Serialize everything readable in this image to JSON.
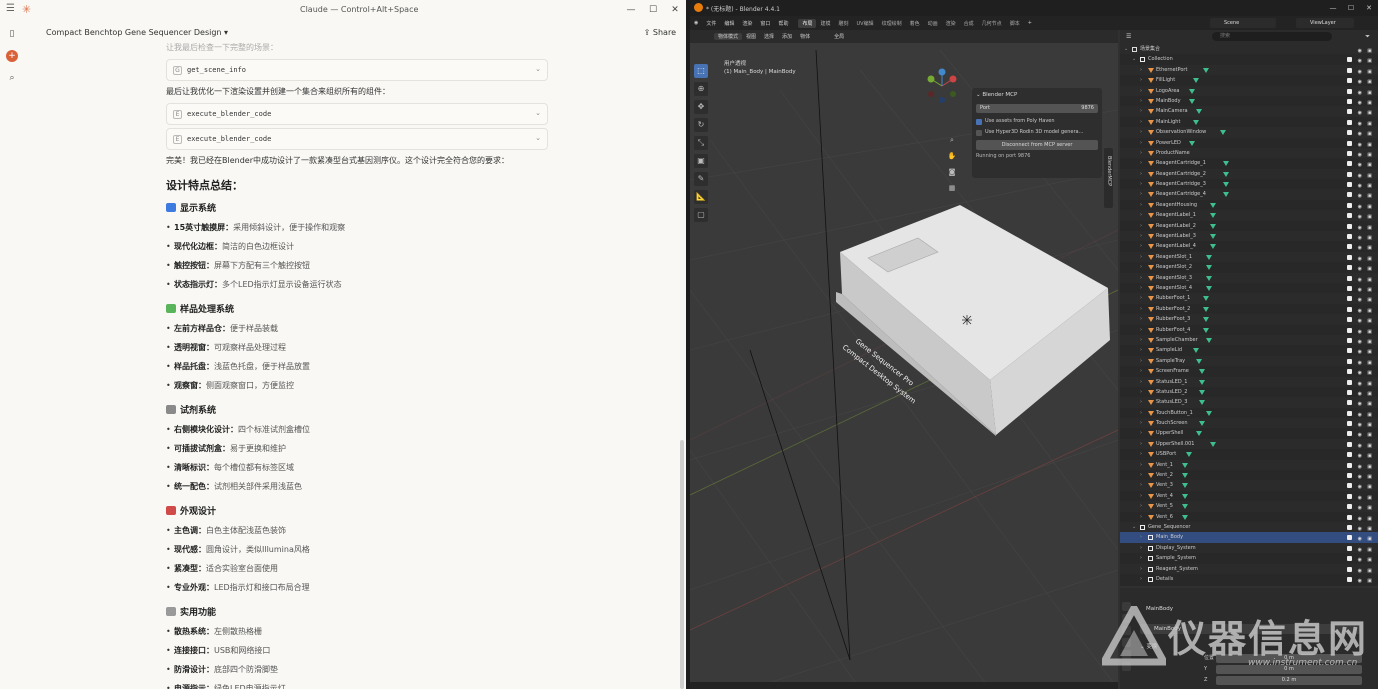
{
  "claude": {
    "window_title": "Claude — Control+Alt+Space",
    "doc_title": "Compact Benchtop Gene Sequencer Design",
    "share_label": "Share",
    "faded_line": "让我最后检查一下完整的场景：",
    "tools": [
      {
        "name": "get_scene_info"
      },
      {
        "name": "execute_blender_code"
      },
      {
        "name": "execute_blender_code"
      }
    ],
    "mid_text": "最后让我优化一下渲染设置并创建一个集合来组织所有的组件：",
    "done_text": "完美！我已经在Blender中成功设计了一款紧凑型台式基因测序仪。这个设计完全符合您的要求：",
    "summary_title": "设计特点总结：",
    "sections": [
      {
        "title": "显示系统",
        "icon_color": "#3d7be0",
        "items": [
          {
            "term": "15英寸触摸屏：",
            "desc": "采用倾斜设计，便于操作和观察"
          },
          {
            "term": "现代化边框：",
            "desc": "简洁的白色边框设计"
          },
          {
            "term": "触控按钮：",
            "desc": "屏幕下方配有三个触控按钮"
          },
          {
            "term": "状态指示灯：",
            "desc": "多个LED指示灯显示设备运行状态"
          }
        ]
      },
      {
        "title": "样品处理系统",
        "icon_color": "#5ab55a",
        "items": [
          {
            "term": "左前方样品仓：",
            "desc": "便于样品装载"
          },
          {
            "term": "透明视窗：",
            "desc": "可观察样品处理过程"
          },
          {
            "term": "样品托盘：",
            "desc": "浅蓝色托盘，便于样品放置"
          },
          {
            "term": "观察窗：",
            "desc": "侧面观察窗口，方便监控"
          }
        ]
      },
      {
        "title": "试剂系统",
        "icon_color": "#8a8a8a",
        "items": [
          {
            "term": "右侧模块化设计：",
            "desc": "四个标准试剂盒槽位"
          },
          {
            "term": "可插拔试剂盒：",
            "desc": "易于更换和维护"
          },
          {
            "term": "清晰标识：",
            "desc": "每个槽位都有标签区域"
          },
          {
            "term": "统一配色：",
            "desc": "试剂相关部件采用浅蓝色"
          }
        ]
      },
      {
        "title": "外观设计",
        "icon_color": "#d04a4a",
        "items": [
          {
            "term": "主色调：",
            "desc": "白色主体配浅蓝色装饰"
          },
          {
            "term": "现代感：",
            "desc": "圆角设计，类似Illumina风格"
          },
          {
            "term": "紧凑型：",
            "desc": "适合实验室台面使用"
          },
          {
            "term": "专业外观：",
            "desc": "LED指示灯和接口布局合理"
          }
        ]
      },
      {
        "title": "实用功能",
        "icon_color": "#9a9a9a",
        "items": [
          {
            "term": "散热系统：",
            "desc": "左侧散热格栅"
          },
          {
            "term": "连接接口：",
            "desc": "USB和网络接口"
          },
          {
            "term": "防滑设计：",
            "desc": "底部四个防滑脚垫"
          },
          {
            "term": "电源指示：",
            "desc": "绿色LED电源指示灯"
          }
        ]
      }
    ]
  },
  "blender": {
    "title": "* (无标题) - Blender 4.4.1",
    "menus": [
      "文件",
      "编辑",
      "渲染",
      "窗口",
      "帮助"
    ],
    "workspaces": [
      "布局",
      "建模",
      "雕刻",
      "UV编辑",
      "纹理绘制",
      "着色",
      "动画",
      "渲染",
      "合成",
      "几何节点",
      "脚本"
    ],
    "active_workspace": "布局",
    "scene": "Scene",
    "view_layer": "ViewLayer",
    "viewport_header": [
      "物体模式",
      "视图",
      "选择",
      "添加",
      "物体"
    ],
    "transform_orientation": "全局",
    "view_name": "用户透视",
    "view_sub": "(1) Main_Body | MainBody",
    "mcp_panel": {
      "title": "Blender MCP",
      "port_label": "Port",
      "port_value": "9876",
      "check1": "Use assets from Poly Haven",
      "check2": "Use Hyper3D Rodin 3D model genera...",
      "button": "Disconnect from MCP server",
      "status": "Running on port 9876",
      "tab": "BlenderMCP"
    },
    "model_text_line1": "Gene Sequencer Pro",
    "model_text_line2": "Compact Desktop System",
    "outliner_search_placeholder": "搜索",
    "outliner": [
      {
        "name": "场景集合",
        "indent": 0,
        "type": "scene"
      },
      {
        "name": "Collection",
        "indent": 1,
        "type": "collection"
      },
      {
        "name": "EthernetPort",
        "indent": 2,
        "type": "mesh",
        "mod": 1
      },
      {
        "name": "FillLight",
        "indent": 2,
        "type": "light",
        "mod": 1
      },
      {
        "name": "LogoArea",
        "indent": 2,
        "type": "mesh",
        "mod": 1
      },
      {
        "name": "MainBody",
        "indent": 2,
        "type": "mesh",
        "mod": 1
      },
      {
        "name": "MainCamera",
        "indent": 2,
        "type": "camera",
        "mod": 1
      },
      {
        "name": "MainLight",
        "indent": 2,
        "type": "light",
        "mod": 1
      },
      {
        "name": "ObservationWindow",
        "indent": 2,
        "type": "mesh",
        "mod": 1
      },
      {
        "name": "PowerLED",
        "indent": 2,
        "type": "mesh",
        "mod": 1
      },
      {
        "name": "ProductName",
        "indent": 2,
        "type": "text",
        "mod": 0
      },
      {
        "name": "ReagentCartridge_1",
        "indent": 2,
        "type": "mesh",
        "mod": 1
      },
      {
        "name": "ReagentCartridge_2",
        "indent": 2,
        "type": "mesh",
        "mod": 1
      },
      {
        "name": "ReagentCartridge_3",
        "indent": 2,
        "type": "mesh",
        "mod": 1
      },
      {
        "name": "ReagentCartridge_4",
        "indent": 2,
        "type": "mesh",
        "mod": 1
      },
      {
        "name": "ReagentHousing",
        "indent": 2,
        "type": "mesh",
        "mod": 1
      },
      {
        "name": "ReagentLabel_1",
        "indent": 2,
        "type": "mesh",
        "mod": 1
      },
      {
        "name": "ReagentLabel_2",
        "indent": 2,
        "type": "mesh",
        "mod": 1
      },
      {
        "name": "ReagentLabel_3",
        "indent": 2,
        "type": "mesh",
        "mod": 1
      },
      {
        "name": "ReagentLabel_4",
        "indent": 2,
        "type": "mesh",
        "mod": 1
      },
      {
        "name": "ReagentSlot_1",
        "indent": 2,
        "type": "mesh",
        "mod": 1
      },
      {
        "name": "ReagentSlot_2",
        "indent": 2,
        "type": "mesh",
        "mod": 1
      },
      {
        "name": "ReagentSlot_3",
        "indent": 2,
        "type": "mesh",
        "mod": 1
      },
      {
        "name": "ReagentSlot_4",
        "indent": 2,
        "type": "mesh",
        "mod": 1
      },
      {
        "name": "RubberFoot_1",
        "indent": 2,
        "type": "mesh",
        "mod": 1
      },
      {
        "name": "RubberFoot_2",
        "indent": 2,
        "type": "mesh",
        "mod": 1
      },
      {
        "name": "RubberFoot_3",
        "indent": 2,
        "type": "mesh",
        "mod": 1
      },
      {
        "name": "RubberFoot_4",
        "indent": 2,
        "type": "mesh",
        "mod": 1
      },
      {
        "name": "SampleChamber",
        "indent": 2,
        "type": "mesh",
        "mod": 1
      },
      {
        "name": "SampleLid",
        "indent": 2,
        "type": "mesh",
        "mod": 1
      },
      {
        "name": "SampleTray",
        "indent": 2,
        "type": "mesh",
        "mod": 1
      },
      {
        "name": "ScreenFrame",
        "indent": 2,
        "type": "mesh",
        "mod": 1
      },
      {
        "name": "StatusLED_1",
        "indent": 2,
        "type": "mesh",
        "mod": 1
      },
      {
        "name": "StatusLED_2",
        "indent": 2,
        "type": "mesh",
        "mod": 1
      },
      {
        "name": "StatusLED_3",
        "indent": 2,
        "type": "mesh",
        "mod": 1
      },
      {
        "name": "TouchButton_1",
        "indent": 2,
        "type": "mesh",
        "mod": 1
      },
      {
        "name": "TouchScreen",
        "indent": 2,
        "type": "mesh",
        "mod": 1
      },
      {
        "name": "UpperShell",
        "indent": 2,
        "type": "mesh",
        "mod": 1
      },
      {
        "name": "UpperShell.001",
        "indent": 2,
        "type": "mesh",
        "mod": 1
      },
      {
        "name": "USBPort",
        "indent": 2,
        "type": "mesh",
        "mod": 1
      },
      {
        "name": "Vent_1",
        "indent": 2,
        "type": "mesh",
        "mod": 1
      },
      {
        "name": "Vent_2",
        "indent": 2,
        "type": "mesh",
        "mod": 1
      },
      {
        "name": "Vent_3",
        "indent": 2,
        "type": "mesh",
        "mod": 1
      },
      {
        "name": "Vent_4",
        "indent": 2,
        "type": "mesh",
        "mod": 1
      },
      {
        "name": "Vent_5",
        "indent": 2,
        "type": "mesh",
        "mod": 1
      },
      {
        "name": "Vent_6",
        "indent": 2,
        "type": "mesh",
        "mod": 1
      },
      {
        "name": "Gene_Sequencer",
        "indent": 1,
        "type": "collection"
      },
      {
        "name": "Main_Body",
        "indent": 2,
        "type": "collection",
        "selected": true
      },
      {
        "name": "Display_System",
        "indent": 2,
        "type": "collection"
      },
      {
        "name": "Sample_System",
        "indent": 2,
        "type": "collection"
      },
      {
        "name": "Reagent_System",
        "indent": 2,
        "type": "collection"
      },
      {
        "name": "Details",
        "indent": 2,
        "type": "collection"
      }
    ],
    "properties": {
      "object_name": "MainBody",
      "field_name": "MainBody",
      "section": "变换",
      "loc_label": "位置 X",
      "x_value": "0 m",
      "y_label": "Y",
      "y_value": "0 m",
      "z_label": "Z",
      "z_value": "0.2 m"
    }
  },
  "watermark": {
    "title": "仪器信息网",
    "url": "www.instrument.com.cn"
  }
}
